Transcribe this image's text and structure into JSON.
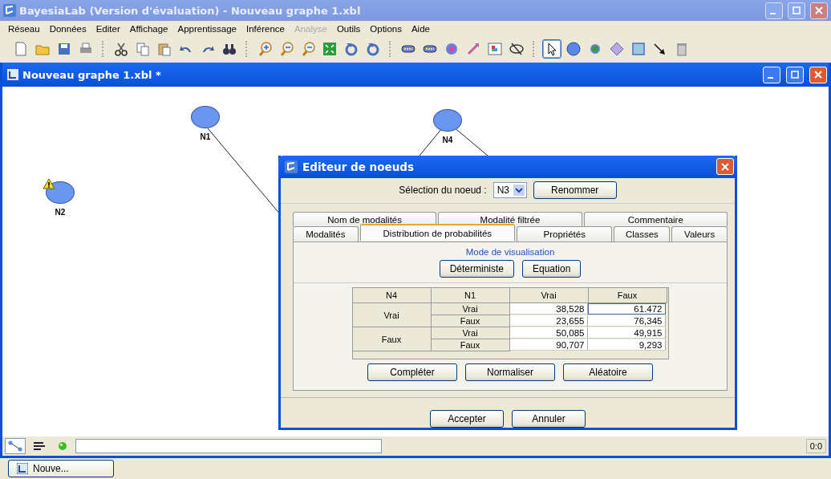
{
  "window": {
    "title": "BayesiaLab (Version d'évaluation) - Nouveau graphe 1.xbl"
  },
  "menu": [
    {
      "label": "Réseau",
      "disabled": false
    },
    {
      "label": "Données",
      "disabled": false
    },
    {
      "label": "Editer",
      "disabled": false
    },
    {
      "label": "Affichage",
      "disabled": false
    },
    {
      "label": "Apprentissage",
      "disabled": false
    },
    {
      "label": "Inférence",
      "disabled": false
    },
    {
      "label": "Analyse",
      "disabled": true
    },
    {
      "label": "Outils",
      "disabled": false
    },
    {
      "label": "Options",
      "disabled": false
    },
    {
      "label": "Aide",
      "disabled": false
    }
  ],
  "toolbar": [
    {
      "kind": "new",
      "selected": false
    },
    {
      "kind": "open",
      "selected": false
    },
    {
      "kind": "save",
      "selected": false
    },
    {
      "kind": "print",
      "selected": false
    },
    {
      "kind": "sep"
    },
    {
      "kind": "cut",
      "selected": false
    },
    {
      "kind": "copy",
      "selected": false
    },
    {
      "kind": "paste",
      "selected": false
    },
    {
      "kind": "undo",
      "selected": false
    },
    {
      "kind": "redo",
      "selected": false
    },
    {
      "kind": "find",
      "selected": false
    },
    {
      "kind": "sep"
    },
    {
      "kind": "zoomin",
      "selected": false
    },
    {
      "kind": "zoomout",
      "selected": false
    },
    {
      "kind": "zoomback",
      "selected": false
    },
    {
      "kind": "fit",
      "selected": false
    },
    {
      "kind": "rotleft",
      "selected": false
    },
    {
      "kind": "rotright",
      "selected": false
    },
    {
      "kind": "sep"
    },
    {
      "kind": "link",
      "selected": false
    },
    {
      "kind": "link",
      "selected": false
    },
    {
      "kind": "target",
      "selected": false
    },
    {
      "kind": "plug",
      "selected": false
    },
    {
      "kind": "palette",
      "selected": false
    },
    {
      "kind": "hide",
      "selected": false
    },
    {
      "kind": "sep"
    },
    {
      "kind": "pointer",
      "selected": true
    },
    {
      "kind": "node",
      "selected": false
    },
    {
      "kind": "dot",
      "selected": false
    },
    {
      "kind": "diamond",
      "selected": false
    },
    {
      "kind": "square",
      "selected": false
    },
    {
      "kind": "arrow",
      "selected": false
    },
    {
      "kind": "trash",
      "selected": false
    }
  ],
  "document": {
    "title": "Nouveau graphe 1.xbl *"
  },
  "nodes": [
    {
      "label": "N1",
      "warning": false
    },
    {
      "label": "N4",
      "warning": false
    },
    {
      "label": "N2",
      "warning": true
    }
  ],
  "dialog": {
    "title": "Editeur de noeuds",
    "selector_label": "Sélection du noeud :",
    "selected_node": "N3",
    "rename_button": "Renommer",
    "tabs_back": [
      {
        "label": "Nom de modalités",
        "selected": false
      },
      {
        "label": "Modalité filtrée",
        "selected": false
      },
      {
        "label": "Commentaire",
        "selected": false
      }
    ],
    "tabs_front": [
      {
        "label": "Modalités",
        "selected": false
      },
      {
        "label": "Distribution de probabilités",
        "selected": true
      },
      {
        "label": "Propriétés",
        "selected": false
      },
      {
        "label": "Classes",
        "selected": false
      },
      {
        "label": "Valeurs",
        "selected": false
      }
    ],
    "mode_label": "Mode de visualisation",
    "mode_buttons": [
      "Déterministe",
      "Equation"
    ],
    "table": {
      "columns": [
        "N4",
        "N1",
        "Vrai",
        "Faux"
      ],
      "groups": [
        {
          "label": "Vrai",
          "rows": [
            {
              "label": "Vrai",
              "cells": [
                {
                  "text": "38,528",
                  "focused": false
                },
                {
                  "text": "61.472",
                  "focused": true
                }
              ]
            },
            {
              "label": "Faux",
              "cells": [
                {
                  "text": "23,655",
                  "focused": false
                },
                {
                  "text": "76,345",
                  "focused": false
                }
              ]
            }
          ]
        },
        {
          "label": "Faux",
          "rows": [
            {
              "label": "Vrai",
              "cells": [
                {
                  "text": "50,085",
                  "focused": false
                },
                {
                  "text": "49,915",
                  "focused": false
                }
              ]
            },
            {
              "label": "Faux",
              "cells": [
                {
                  "text": "90,707",
                  "focused": false
                },
                {
                  "text": "9,293",
                  "focused": false
                }
              ]
            }
          ]
        }
      ]
    },
    "action_buttons": [
      "Compléter",
      "Normaliser",
      "Aléatoire"
    ],
    "footer_buttons": [
      "Accepter",
      "Annuler"
    ]
  },
  "status_bar": {
    "reading": "0:0"
  },
  "taskbar": [
    {
      "label": "Nouve...",
      "selected": false
    }
  ]
}
